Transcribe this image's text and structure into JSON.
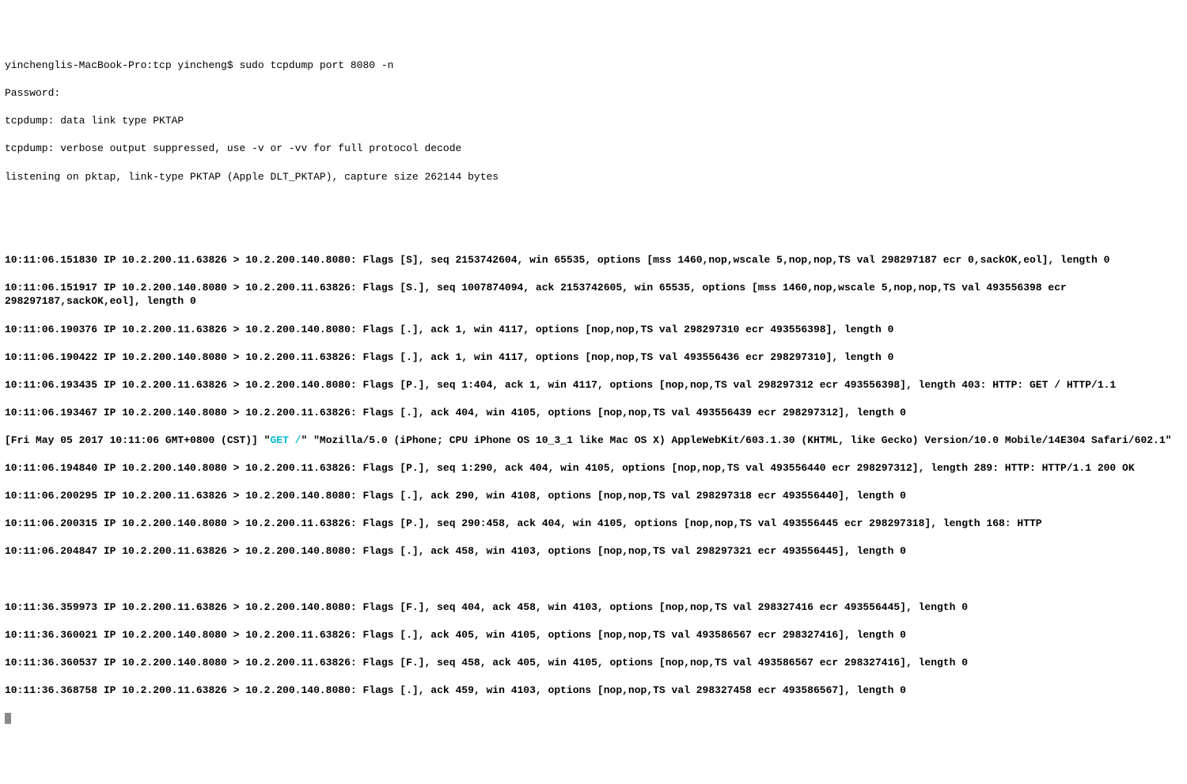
{
  "term": {
    "prompt": "yinchenglis-MacBook-Pro:tcp yincheng$ sudo tcpdump port 8080 -n",
    "password": "Password:",
    "msg1": "tcpdump: data link type PKTAP",
    "msg2": "tcpdump: verbose output suppressed, use -v or -vv for full protocol decode",
    "msg3": "listening on pktap, link-type PKTAP (Apple DLT_PKTAP), capture size 262144 bytes",
    "p01a": "10:11:06.151830 IP 10.2.200.11.63826 > 10.2.200.140.8080: Flags [S], seq 2153742604, win 65535, options [mss 1460,nop,wscale 5,nop,nop,TS val 298297187 ecr 0,sackOK,eol], length 0",
    "p02a": "10:11:06.151917 IP 10.2.200.140.8080 > 10.2.200.11.63826: Flags [S.], seq 1007874094, ack 2153742605, win 65535, options [mss 1460,nop,wscale 5,nop,nop,TS val 493556398 ecr 298297187,sackOK,eol], length 0",
    "p03": "10:11:06.190376 IP 10.2.200.11.63826 > 10.2.200.140.8080: Flags [.], ack 1, win 4117, options [nop,nop,TS val 298297310 ecr 493556398], length 0",
    "p04": "10:11:06.190422 IP 10.2.200.140.8080 > 10.2.200.11.63826: Flags [.], ack 1, win 4117, options [nop,nop,TS val 493556436 ecr 298297310], length 0",
    "p05a": "10:11:06.193435 IP 10.2.200.11.63826 > 10.2.200.140.8080: Flags [P.], seq 1:404, ack 1, win 4117, options [nop,nop,TS val 298297312 ecr 493556398], length 403: HTTP: GET / HTTP/1.1",
    "p06": "10:11:06.193467 IP 10.2.200.140.8080 > 10.2.200.11.63826: Flags [.], ack 404, win 4105, options [nop,nop,TS val 493556439 ecr 298297312], length 0",
    "httpline_pre": "[Fri May 05 2017 10:11:06 GMT+0800 (CST)] \"",
    "httpline_get": "GET /",
    "httpline_post": "\" \"Mozilla/5.0 (iPhone; CPU iPhone OS 10_3_1 like Mac OS X) AppleWebKit/603.1.30 (KHTML, like Gecko) Version/10.0 Mobile/14E304 Safari/602.1\"",
    "p07a": "10:11:06.194840 IP 10.2.200.140.8080 > 10.2.200.11.63826: Flags [P.], seq 1:290, ack 404, win 4105, options [nop,nop,TS val 493556440 ecr 298297312], length 289: HTTP: HTTP/1.1 200 OK",
    "p08": "10:11:06.200295 IP 10.2.200.11.63826 > 10.2.200.140.8080: Flags [.], ack 290, win 4108, options [nop,nop,TS val 298297318 ecr 493556440], length 0",
    "p09": "10:11:06.200315 IP 10.2.200.140.8080 > 10.2.200.11.63826: Flags [P.], seq 290:458, ack 404, win 4105, options [nop,nop,TS val 493556445 ecr 298297318], length 168: HTTP",
    "p10": "10:11:06.204847 IP 10.2.200.11.63826 > 10.2.200.140.8080: Flags [.], ack 458, win 4103, options [nop,nop,TS val 298297321 ecr 493556445], length 0",
    "p11": "10:11:36.359973 IP 10.2.200.11.63826 > 10.2.200.140.8080: Flags [F.], seq 404, ack 458, win 4103, options [nop,nop,TS val 298327416 ecr 493556445], length 0",
    "p12": "10:11:36.360021 IP 10.2.200.140.8080 > 10.2.200.11.63826: Flags [.], ack 405, win 4105, options [nop,nop,TS val 493586567 ecr 298327416], length 0",
    "p13": "10:11:36.360537 IP 10.2.200.140.8080 > 10.2.200.11.63826: Flags [F.], seq 458, ack 405, win 4105, options [nop,nop,TS val 493586567 ecr 298327416], length 0",
    "p14": "10:11:36.368758 IP 10.2.200.11.63826 > 10.2.200.140.8080: Flags [.], ack 459, win 4103, options [nop,nop,TS val 298327458 ecr 493586567], length 0"
  }
}
